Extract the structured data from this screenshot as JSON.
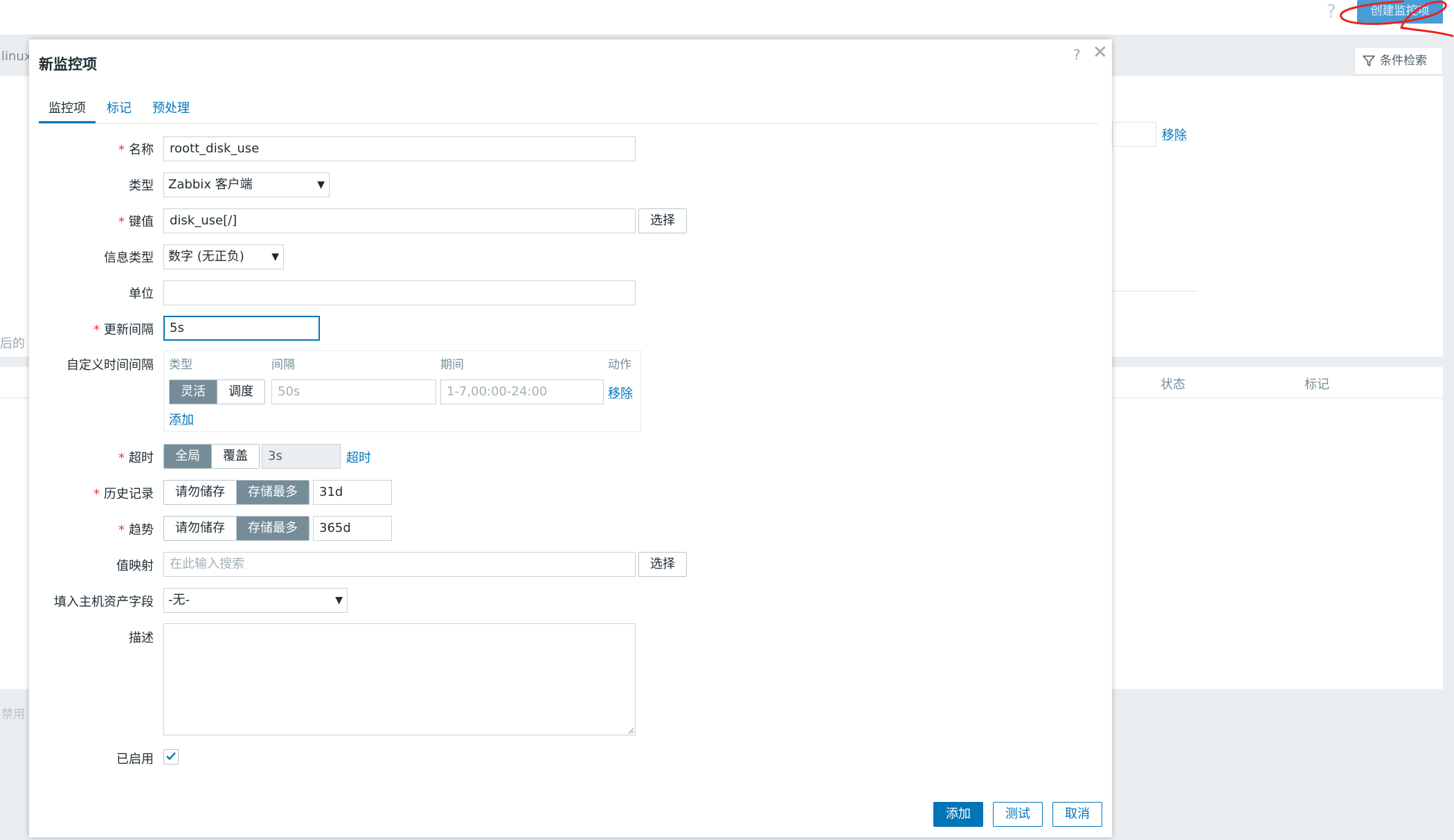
{
  "background": {
    "help_mark": "?",
    "create_button": "创建监控项",
    "breadcrumb_cut": "linux",
    "filter_label": "条件检索",
    "remove_link": "移除",
    "col_status": "状态",
    "col_tags": "标记",
    "left_cut_text": "后的",
    "left_cut_disable": "禁用"
  },
  "modal": {
    "title": "新监控项",
    "help": "?",
    "close": "✕",
    "tabs": [
      {
        "label": "监控项",
        "active": true
      },
      {
        "label": "标记",
        "active": false
      },
      {
        "label": "预处理",
        "active": false
      }
    ],
    "form": {
      "name": {
        "label": "名称",
        "value": "roott_disk_use"
      },
      "type": {
        "label": "类型",
        "value": "Zabbix 客户端"
      },
      "key": {
        "label": "键值",
        "value": "disk_use[/]",
        "button": "选择"
      },
      "info_type": {
        "label": "信息类型",
        "value": "数字 (无正负)"
      },
      "units": {
        "label": "单位",
        "value": ""
      },
      "update_interval": {
        "label": "更新间隔",
        "value": "5s"
      },
      "custom_intervals": {
        "label": "自定义时间间隔",
        "headers": [
          "类型",
          "间隔",
          "期间",
          "动作"
        ],
        "row": {
          "mode_options": [
            "灵活",
            "调度"
          ],
          "mode_selected": "灵活",
          "interval_placeholder": "50s",
          "period_placeholder": "1-7,00:00-24:00",
          "remove": "移除"
        },
        "add": "添加"
      },
      "timeout": {
        "label": "超时",
        "options": [
          "全局",
          "覆盖"
        ],
        "selected": "全局",
        "value": "3s",
        "link": "超时"
      },
      "history": {
        "label": "历史记录",
        "options": [
          "请勿储存",
          "存储最多"
        ],
        "selected": "存储最多",
        "value": "31d"
      },
      "trends": {
        "label": "趋势",
        "options": [
          "请勿储存",
          "存储最多"
        ],
        "selected": "存储最多",
        "value": "365d"
      },
      "value_map": {
        "label": "值映射",
        "placeholder": "在此输入搜索",
        "button": "选择"
      },
      "inventory": {
        "label": "填入主机资产字段",
        "value": "-无-"
      },
      "description": {
        "label": "描述",
        "value": ""
      },
      "enabled": {
        "label": "已启用",
        "checked": true
      }
    },
    "footer": {
      "add": "添加",
      "test": "测试",
      "cancel": "取消"
    }
  },
  "colors": {
    "accent": "#0275b8",
    "required": "#e33734",
    "segment_on": "#768d99",
    "annotation": "#e8231d"
  }
}
